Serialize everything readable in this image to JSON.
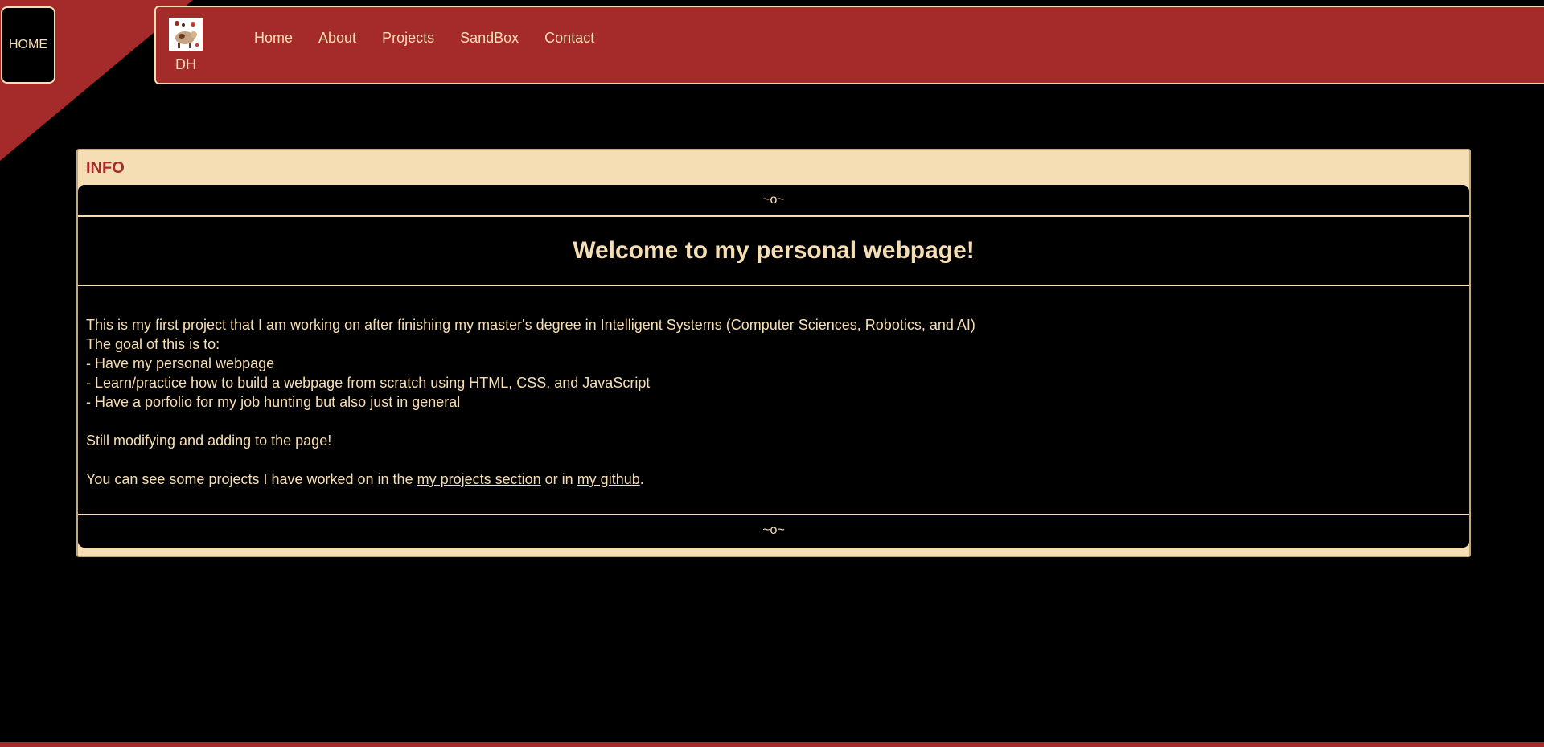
{
  "colors": {
    "background": "#000000",
    "accent": "#a52a2a",
    "text": "#f5deb3",
    "panel": "#f5deb3"
  },
  "home_badge": {
    "label": "HOME"
  },
  "navbar": {
    "logo_initials": "DH",
    "links": [
      "Home",
      "About",
      "Projects",
      "SandBox",
      "Contact"
    ]
  },
  "info": {
    "title": "INFO",
    "ornament_top": "~o~",
    "ornament_bottom": "~o~",
    "heading": "Welcome to my personal webpage!",
    "lines": [
      "This is my first project that I am working on after finishing my master's degree in Intelligent Systems (Computer Sciences, Robotics, and AI)",
      "The goal of this is to:",
      "- Have my personal webpage",
      "- Learn/practice how to build a webpage from scratch using HTML, CSS, and JavaScript",
      "- Have a porfolio for my job hunting but also just in general",
      "",
      "Still modifying and adding to the page!",
      ""
    ],
    "projects_sentence": {
      "prefix": "You can see some projects I have worked on in the ",
      "projects_link": "my projects section",
      "middle": " or in ",
      "github_link": "my github",
      "suffix": "."
    }
  }
}
